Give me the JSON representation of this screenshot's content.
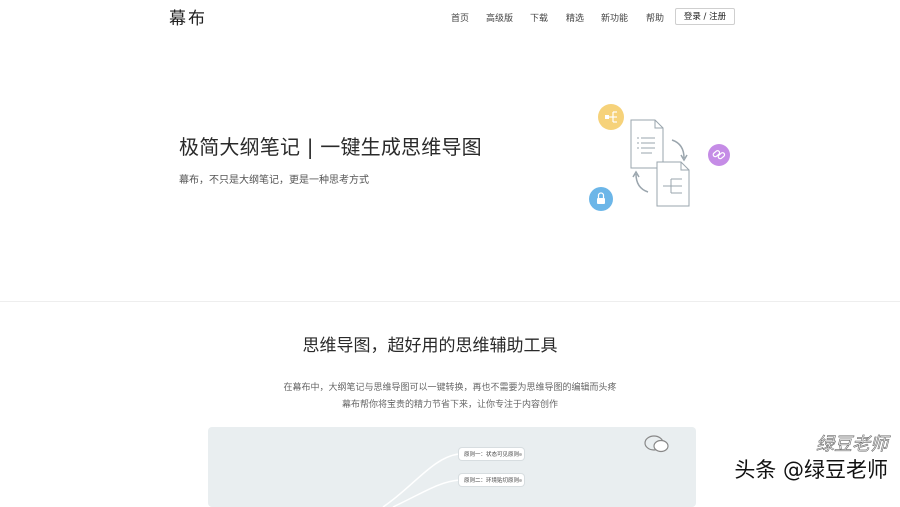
{
  "header": {
    "logo": "幕布",
    "nav": [
      "首页",
      "高级版",
      "下载",
      "精选",
      "新功能",
      "帮助"
    ],
    "login": "登录 / 注册"
  },
  "hero": {
    "title": "极简大纲笔记 | 一键生成思维导图",
    "subtitle": "幕布，不只是大纲笔记，更是一种思考方式",
    "icons": [
      "share-tree-icon",
      "document-list-icon",
      "document-mindmap-icon",
      "link-icon",
      "lock-icon"
    ]
  },
  "section": {
    "title": "思维导图，超好用的思维辅助工具",
    "desc_line1": "在幕布中，大纲笔记与思维导图可以一键转换，再也不需要为思维导图的编辑而头疼",
    "desc_line2": "幕布帮你将宝贵的精力节省下来，让你专注于内容创作",
    "preview_nodes": [
      "原则一：状态可见原则",
      "原则二：环境贴切原则"
    ]
  },
  "watermark": {
    "top": "绿豆老师",
    "bottom": "头条 @绿豆老师"
  },
  "colors": {
    "yellow_icon": "#f6d27a",
    "purple_icon": "#c58ce6",
    "blue_icon": "#6cb6e8",
    "preview_bg": "#e9eef0"
  }
}
